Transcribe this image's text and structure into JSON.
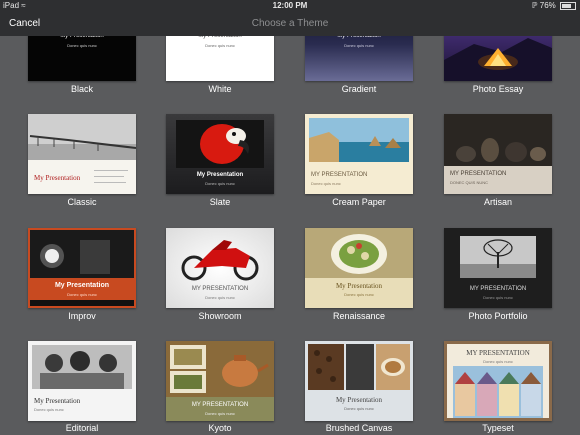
{
  "status": {
    "device": "iPad",
    "time": "12:00 PM",
    "battery": "76%",
    "battery_level": 0.76
  },
  "nav": {
    "cancel": "Cancel",
    "title": "Choose a Theme"
  },
  "themes": [
    {
      "label": "Black",
      "title": "My Presentation",
      "subtitle": "Donec quis nunc"
    },
    {
      "label": "White",
      "title": "My Presentation",
      "subtitle": "Donec quis nunc"
    },
    {
      "label": "Gradient",
      "title": "My Presentation",
      "subtitle": "Donec quis nunc"
    },
    {
      "label": "Photo Essay"
    },
    {
      "label": "Classic",
      "title": "My Presentation"
    },
    {
      "label": "Slate",
      "title": "My Presentation",
      "subtitle": "Donec quis nunc"
    },
    {
      "label": "Cream Paper",
      "title": "MY PRESENTATION",
      "subtitle": "Donec quis nunc"
    },
    {
      "label": "Artisan",
      "title": "MY PRESENTATION",
      "subtitle": "DONEC QUIS NUNC"
    },
    {
      "label": "Improv",
      "title": "My Presentation",
      "subtitle": "Donec quis nunc"
    },
    {
      "label": "Showroom",
      "title": "MY PRESENTATION",
      "subtitle": "Donec quis nunc"
    },
    {
      "label": "Renaissance",
      "title": "My Presentation",
      "subtitle": "Donec quis nunc"
    },
    {
      "label": "Photo Portfolio",
      "title": "MY PRESENTATION",
      "subtitle": "Donec quis nunc"
    },
    {
      "label": "Editorial",
      "title": "My Presentation",
      "subtitle": "Donec quis nunc"
    },
    {
      "label": "Kyoto",
      "title": "MY PRESENTATION",
      "subtitle": "Donec quis nunc"
    },
    {
      "label": "Brushed Canvas",
      "title": "My Presentation",
      "subtitle": "Donec quis nunc"
    },
    {
      "label": "Typeset",
      "title": "MY PRESENTATION",
      "subtitle": "Donec quis nunc"
    }
  ]
}
